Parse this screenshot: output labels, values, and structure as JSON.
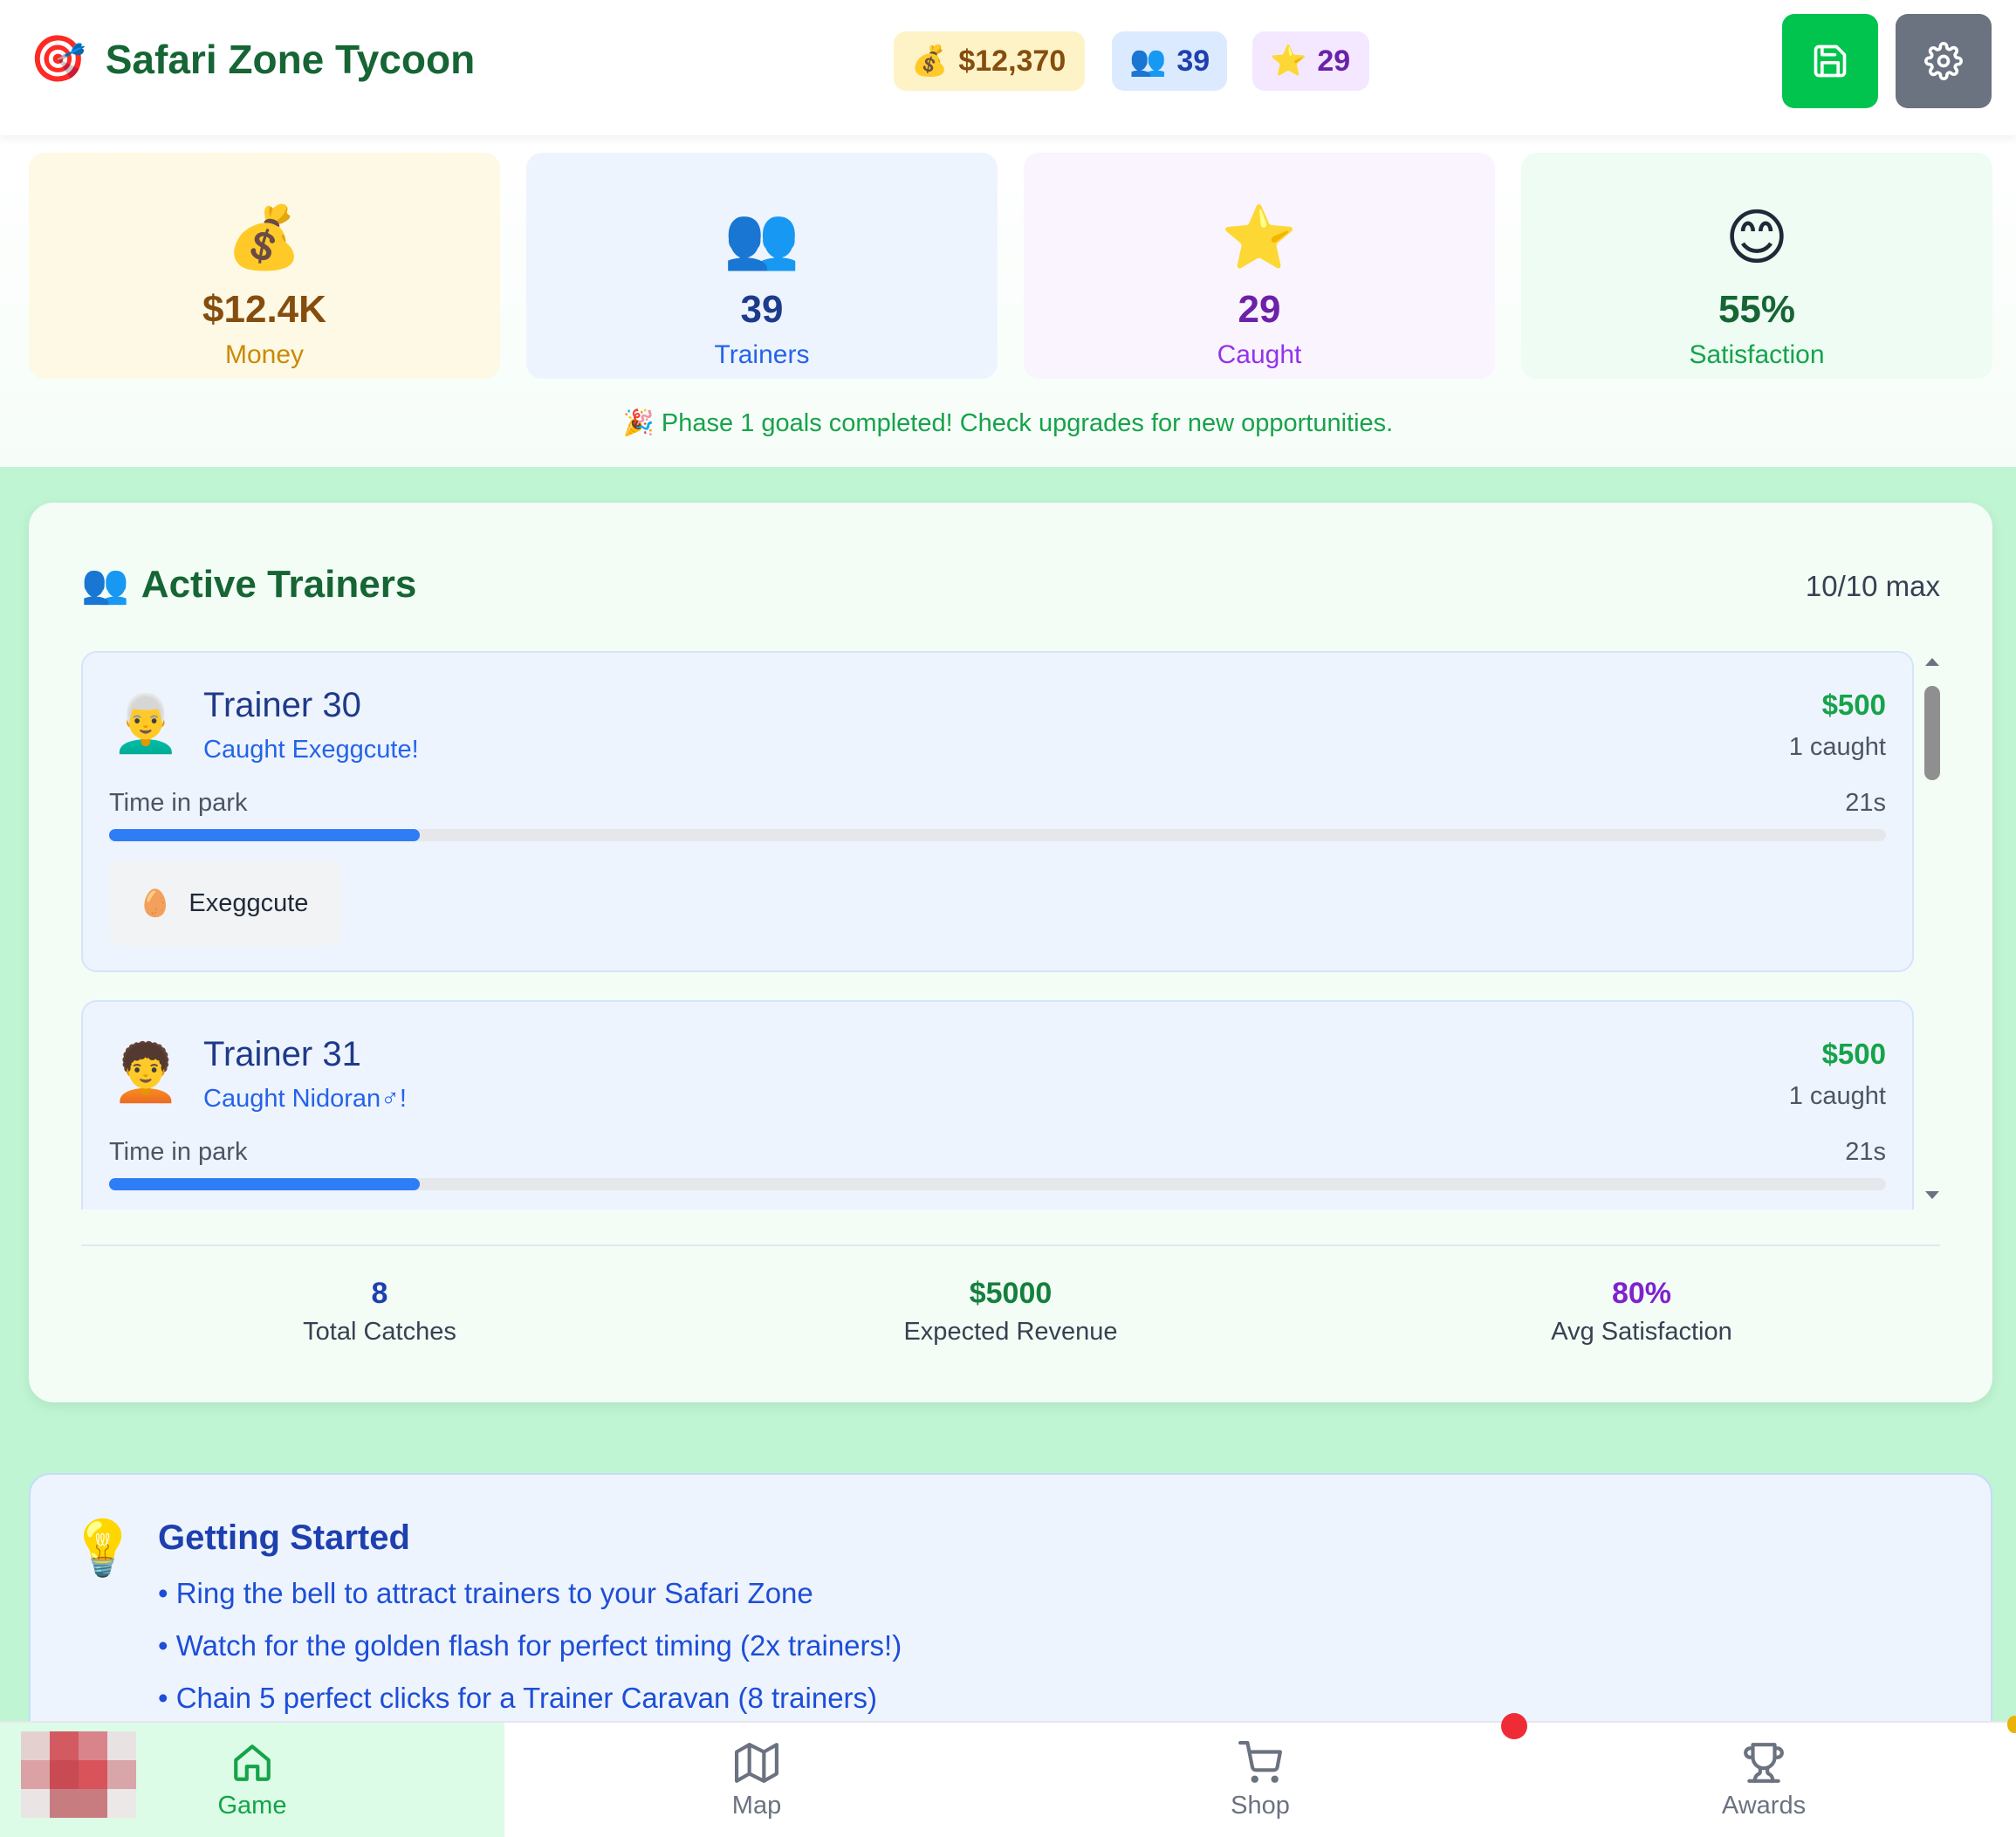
{
  "app": {
    "title": "Safari Zone Tycoon",
    "logo_icon": "🎯"
  },
  "header": {
    "money": {
      "icon": "💰",
      "value": "$12,370"
    },
    "trainers": {
      "icon": "👥",
      "value": "39"
    },
    "caught": {
      "icon": "⭐",
      "value": "29"
    },
    "save_icon": "save-icon",
    "settings_icon": "gear-icon",
    "save_color": "#00c44e",
    "settings_color": "#6b7280"
  },
  "stats": [
    {
      "icon": "💰",
      "value": "$12.4K",
      "label": "Money"
    },
    {
      "icon": "👥",
      "value": "39",
      "label": "Trainers"
    },
    {
      "icon": "⭐",
      "value": "29",
      "label": "Caught"
    },
    {
      "icon": "😊",
      "value": "55%",
      "label": "Satisfaction"
    }
  ],
  "phase_message": "🎉 Phase 1 goals completed! Check upgrades for new opportunities.",
  "active_trainers": {
    "icon": "👥",
    "title": "Active Trainers",
    "capacity": "10/10 max",
    "time_label": "Time in park",
    "trainers": [
      {
        "avatar": "👨‍🦳",
        "name": "Trainer 30",
        "status": "Caught Exeggcute!",
        "money": "$500",
        "caught": "1 caught",
        "time": "21s",
        "progress": 0.175,
        "pokemon": [
          {
            "icon": "🥚",
            "name": "Exeggcute"
          }
        ]
      },
      {
        "avatar": "🧑‍🦱",
        "name": "Trainer 31",
        "status": "Caught Nidoran♂!",
        "money": "$500",
        "caught": "1 caught",
        "time": "21s",
        "progress": 0.175
      }
    ],
    "summary": [
      {
        "value": "8",
        "label": "Total Catches"
      },
      {
        "value": "$5000",
        "label": "Expected Revenue"
      },
      {
        "value": "80%",
        "label": "Avg Satisfaction"
      }
    ]
  },
  "getting_started": {
    "icon": "💡",
    "title": "Getting Started",
    "tips": [
      "• Ring the bell to attract trainers to your Safari Zone",
      "• Watch for the golden flash for perfect timing (2x trainers!)",
      "• Chain 5 perfect clicks for a Trainer Caravan (8 trainers)"
    ]
  },
  "bottom_nav": [
    {
      "label": "Game",
      "icon": "home-icon",
      "active": true
    },
    {
      "label": "Map",
      "icon": "map-icon"
    },
    {
      "label": "Shop",
      "icon": "cart-icon"
    },
    {
      "label": "Awards",
      "icon": "trophy-icon"
    }
  ],
  "colors": {
    "accent_green": "#16a34a",
    "page_background": "#bff5d3",
    "progress_blue": "#2f7df6",
    "notification_red": "#ef2b36"
  }
}
